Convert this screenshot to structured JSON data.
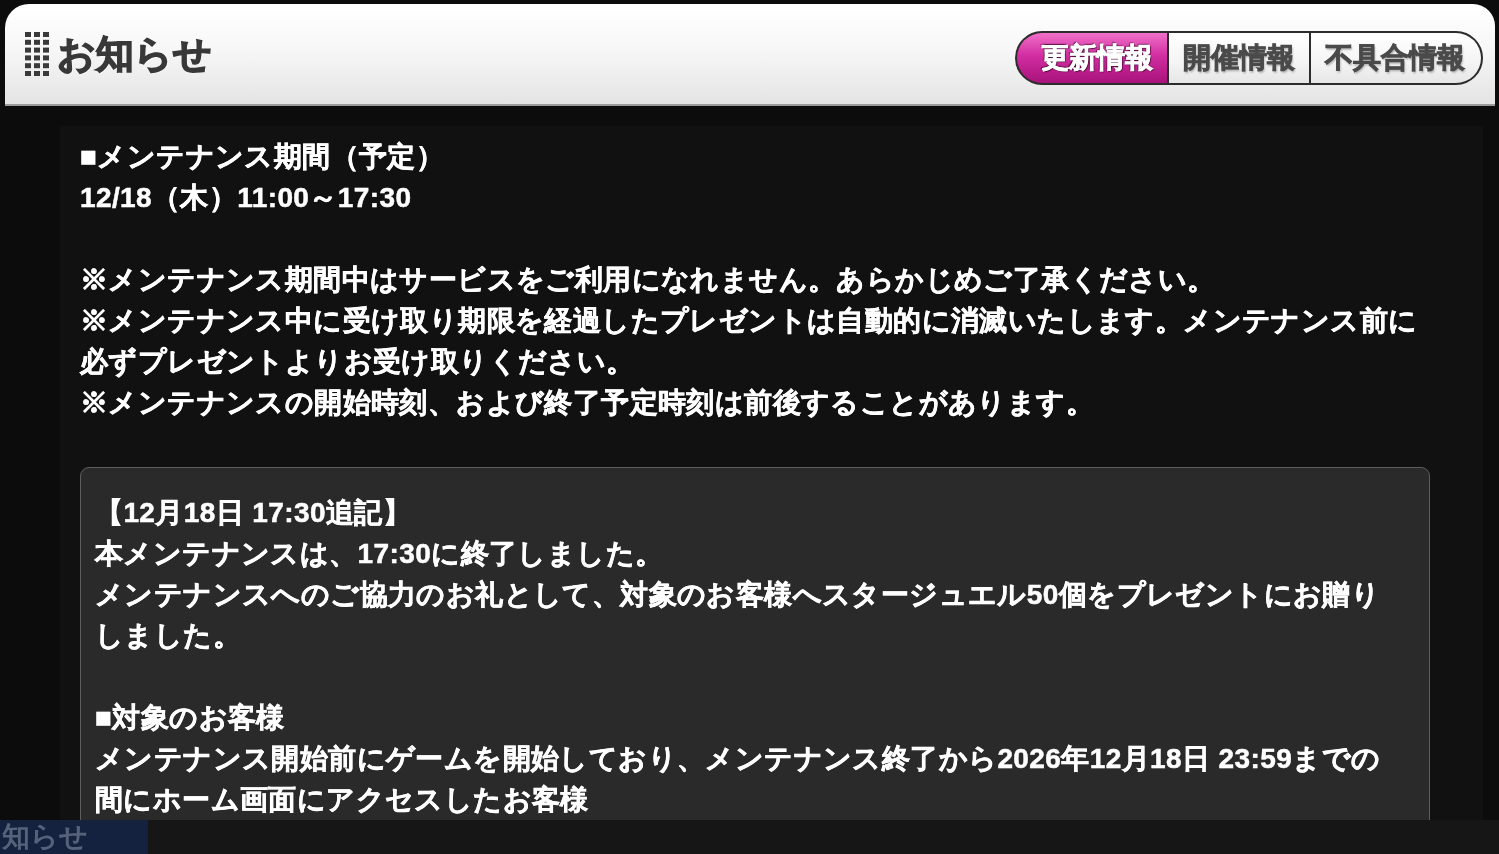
{
  "header": {
    "title": "お知らせ",
    "tabs": [
      {
        "label": "更新情報",
        "selected": true
      },
      {
        "label": "開催情報",
        "selected": false
      },
      {
        "label": "不具合情報",
        "selected": false
      }
    ]
  },
  "notice": {
    "sections": [
      {
        "lines": [
          "■メンテナンス期間（予定）",
          "12/18（木）11:00～17:30"
        ]
      },
      {
        "lines": [
          "※メンテナンス期間中はサービスをご利用になれません。あらかじめご了承ください。",
          "※メンテナンス中に受け取り期限を経過したプレゼントは自動的に消滅いたします。メンテナンス前に必ずプレゼントよりお受け取りください。",
          "※メンテナンスの開始時刻、および終了予定時刻は前後することがあります。"
        ]
      }
    ],
    "addendum": {
      "sections": [
        {
          "lines": [
            "【12月18日 17:30追記】",
            "本メンテナンスは、17:30に終了しました。",
            "メンテナンスへのご協力のお礼として、対象のお客様へスタージュエル50個をプレゼントにお贈りしました。"
          ]
        },
        {
          "lines": [
            "■対象のお客様",
            "メンテナンス開始前にゲームを開始しており、メンテナンス終了から2026年12月18日 23:59までの間にホーム画面にアクセスしたお客様"
          ]
        }
      ]
    }
  },
  "background": {
    "label": "知らせ"
  }
}
